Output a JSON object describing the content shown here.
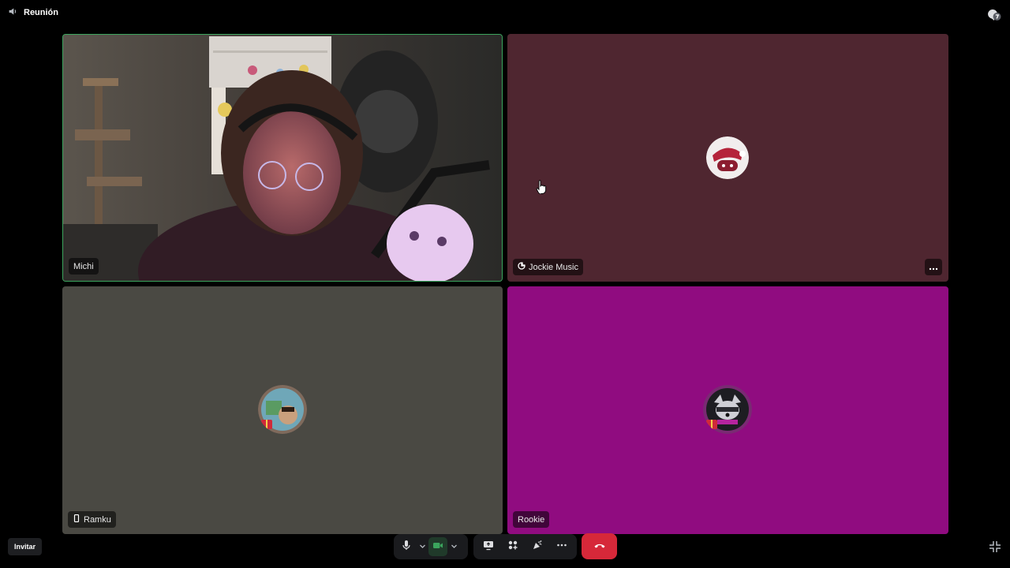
{
  "header": {
    "channel_name": "Reunión",
    "voice_icon": "speaker-icon",
    "activity_icon": "activity-icon"
  },
  "participants": [
    {
      "name": "Michi",
      "speaking": true,
      "video_on": true
    },
    {
      "name": "Jockie Music",
      "badge_icon": "bot-icon"
    },
    {
      "name": "Ramku",
      "badge_icon": "mobile-phone-icon"
    },
    {
      "name": "Rookie"
    }
  ],
  "footer": {
    "invite_label": "Invitar"
  },
  "controls": {
    "mic_icon": "microphone-icon",
    "camera_icon": "video-camera-icon",
    "share_icon": "screen-share-icon",
    "activities_icon": "activities-icon",
    "soundboard_icon": "soundboard-icon",
    "more_icon": "ellipsis-icon",
    "disconnect_icon": "hang-up-icon",
    "fullscreen_icon": "exit-fullscreen-icon"
  },
  "colors": {
    "speaking_border": "#3ba55d",
    "tile_jockie": "#4f2630",
    "tile_ramku": "#4a4943",
    "tile_rookie": "#900c80",
    "hangup": "#d62839"
  }
}
